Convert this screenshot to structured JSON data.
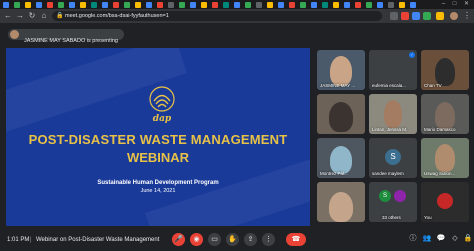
{
  "browser": {
    "url": "meet.google.com/bsa-dsai-fyyfauthusen=1"
  },
  "meet": {
    "presenting_text": "JASMINE MAY SABADO is presenting"
  },
  "slide": {
    "logo_text": "dap",
    "title_line1": "POST-DISASTER WASTE MANAGEMENT",
    "title_line2": "WEBINAR",
    "program": "Sustainable Human Development Program",
    "date": "June 14, 2021"
  },
  "participants": [
    {
      "name": "JASMINE MAY ..."
    },
    {
      "name": "eufemia escala..."
    },
    {
      "name": "Chan TV"
    },
    {
      "name": "Lintan, Jerissa M."
    },
    {
      "name": "Mario Damasco"
    },
    {
      "name": "Montrez Pal..."
    },
    {
      "name": "sandee maylem"
    },
    {
      "name": "Uswag Sialon..."
    },
    {
      "name": "",
      "initial": "S"
    },
    {
      "name": "33 others"
    },
    {
      "name": "You"
    }
  ],
  "bottom": {
    "time": "1:01 PM",
    "separator": "|",
    "meeting_name": "Webinar on Post-Disaster Waste Management"
  },
  "colors": {
    "slide_bg": "#1a3a9a",
    "slide_gold": "#e8c247",
    "end_call": "#ea4335",
    "app_bg": "#202124"
  }
}
